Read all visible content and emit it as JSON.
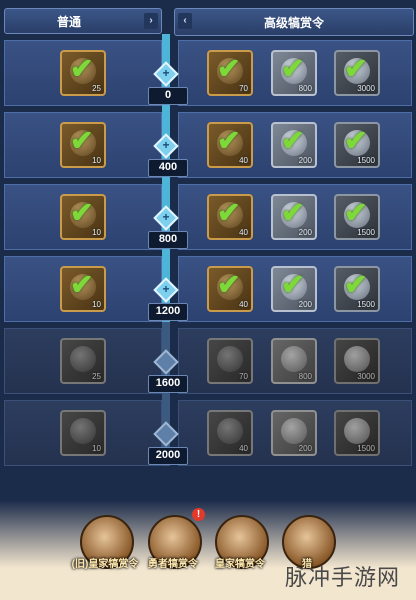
{
  "tabs": {
    "free": "普通",
    "premium": "高级犒赏令",
    "free_arrow": "›",
    "premium_arrow": "‹"
  },
  "tiers": [
    {
      "milestone": "0",
      "claimed": true,
      "free": {
        "qty": "25"
      },
      "premium": [
        {
          "qty": "70",
          "tone": "gold"
        },
        {
          "qty": "800",
          "tone": "silver"
        },
        {
          "qty": "3000",
          "tone": "dark"
        }
      ]
    },
    {
      "milestone": "400",
      "claimed": true,
      "free": {
        "qty": "10"
      },
      "premium": [
        {
          "qty": "40",
          "tone": "gold"
        },
        {
          "qty": "200",
          "tone": "silver"
        },
        {
          "qty": "1500",
          "tone": "dark"
        }
      ]
    },
    {
      "milestone": "800",
      "claimed": true,
      "free": {
        "qty": "10"
      },
      "premium": [
        {
          "qty": "40",
          "tone": "gold"
        },
        {
          "qty": "200",
          "tone": "silver"
        },
        {
          "qty": "1500",
          "tone": "dark"
        }
      ]
    },
    {
      "milestone": "1200",
      "claimed": true,
      "free": {
        "qty": "10"
      },
      "premium": [
        {
          "qty": "40",
          "tone": "gold"
        },
        {
          "qty": "200",
          "tone": "silver"
        },
        {
          "qty": "1500",
          "tone": "dark"
        }
      ]
    },
    {
      "milestone": "1600",
      "claimed": false,
      "free": {
        "qty": "25"
      },
      "premium": [
        {
          "qty": "70",
          "tone": "gold"
        },
        {
          "qty": "800",
          "tone": "silver"
        },
        {
          "qty": "3000",
          "tone": "dark"
        }
      ]
    },
    {
      "milestone": "2000",
      "claimed": false,
      "free": {
        "qty": "10"
      },
      "premium": [
        {
          "qty": "40",
          "tone": "gold"
        },
        {
          "qty": "200",
          "tone": "silver"
        },
        {
          "qty": "1500",
          "tone": "dark"
        }
      ]
    }
  ],
  "check_glyph": "✔",
  "marker_glyph": "+",
  "heroes": [
    {
      "name": "(旧)皇家犒赏令",
      "icon": "hero-portrait-icon"
    },
    {
      "name": "勇者犒赏令",
      "icon": "hero-portrait-icon",
      "badge": "!"
    },
    {
      "name": "皇家犒赏令",
      "icon": "hero-portrait-icon"
    },
    {
      "name": "猎",
      "icon": "hero-portrait-icon"
    }
  ],
  "watermark": "脉冲手游网",
  "colors": {
    "check": "#7dd83a",
    "track": "#4fb5d8",
    "alert": "#e23a2a"
  }
}
